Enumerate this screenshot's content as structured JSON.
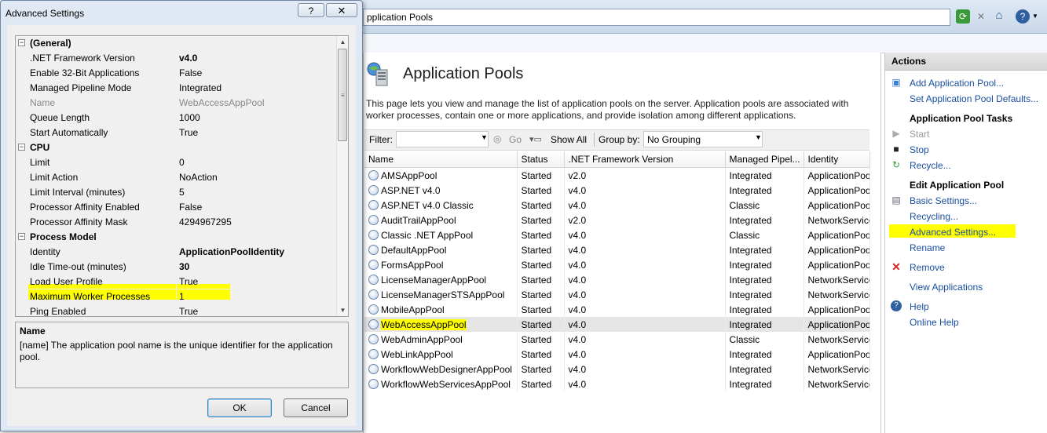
{
  "iis": {
    "address_text": "pplication Pools",
    "page_title": "Application Pools",
    "page_description": "This page lets you view and manage the list of application pools on the server. Application pools are associated with worker processes, contain one or more applications, and provide isolation among different applications.",
    "filter": {
      "label": "Filter:",
      "value": "",
      "go_label": "Go",
      "show_all_label": "Show All",
      "group_by_label": "Group by:",
      "group_by_value": "No Grouping"
    },
    "table": {
      "columns": [
        "Name",
        "Status",
        ".NET Framework Version",
        "Managed Pipel...",
        "Identity"
      ],
      "rows": [
        {
          "name": "AMSAppPool",
          "status": "Started",
          "version": "v2.0",
          "pipeline": "Integrated",
          "identity": "ApplicationPoolIdentity"
        },
        {
          "name": "ASP.NET v4.0",
          "status": "Started",
          "version": "v4.0",
          "pipeline": "Integrated",
          "identity": "ApplicationPoolIdentity"
        },
        {
          "name": "ASP.NET v4.0 Classic",
          "status": "Started",
          "version": "v4.0",
          "pipeline": "Classic",
          "identity": "ApplicationPoolIdentity"
        },
        {
          "name": "AuditTrailAppPool",
          "status": "Started",
          "version": "v2.0",
          "pipeline": "Integrated",
          "identity": "NetworkService"
        },
        {
          "name": "Classic .NET AppPool",
          "status": "Started",
          "version": "v4.0",
          "pipeline": "Classic",
          "identity": "ApplicationPoolIdentity"
        },
        {
          "name": "DefaultAppPool",
          "status": "Started",
          "version": "v4.0",
          "pipeline": "Integrated",
          "identity": "ApplicationPoolIdentity"
        },
        {
          "name": "FormsAppPool",
          "status": "Started",
          "version": "v4.0",
          "pipeline": "Integrated",
          "identity": "ApplicationPoolIdentity"
        },
        {
          "name": "LicenseManagerAppPool",
          "status": "Started",
          "version": "v4.0",
          "pipeline": "Integrated",
          "identity": "NetworkService"
        },
        {
          "name": "LicenseManagerSTSAppPool",
          "status": "Started",
          "version": "v4.0",
          "pipeline": "Integrated",
          "identity": "NetworkService"
        },
        {
          "name": "MobileAppPool",
          "status": "Started",
          "version": "v4.0",
          "pipeline": "Integrated",
          "identity": "ApplicationPoolIdentity"
        },
        {
          "name": "WebAccessAppPool",
          "status": "Started",
          "version": "v4.0",
          "pipeline": "Integrated",
          "identity": "ApplicationPoolIdentity",
          "selected": true
        },
        {
          "name": "WebAdminAppPool",
          "status": "Started",
          "version": "v4.0",
          "pipeline": "Classic",
          "identity": "NetworkService"
        },
        {
          "name": "WebLinkAppPool",
          "status": "Started",
          "version": "v4.0",
          "pipeline": "Integrated",
          "identity": "ApplicationPoolIdentity"
        },
        {
          "name": "WorkflowWebDesignerAppPool",
          "status": "Started",
          "version": "v4.0",
          "pipeline": "Integrated",
          "identity": "NetworkService"
        },
        {
          "name": "WorkflowWebServicesAppPool",
          "status": "Started",
          "version": "v4.0",
          "pipeline": "Integrated",
          "identity": "NetworkService"
        }
      ]
    }
  },
  "actions": {
    "title": "Actions",
    "add_pool": "Add Application Pool...",
    "set_defaults": "Set Application Pool Defaults...",
    "tasks_heading": "Application Pool Tasks",
    "start": "Start",
    "stop": "Stop",
    "recycle": "Recycle...",
    "edit_heading": "Edit Application Pool",
    "basic_settings": "Basic Settings...",
    "recycling": "Recycling...",
    "advanced_settings": "Advanced Settings...",
    "rename": "Rename",
    "remove": "Remove",
    "view_applications": "View Applications",
    "help": "Help",
    "online_help": "Online Help"
  },
  "dialog": {
    "title": "Advanced Settings",
    "help_button": "?",
    "close_button": "✕",
    "categories": {
      "general": "(General)",
      "cpu": "CPU",
      "process_model": "Process Model"
    },
    "properties": {
      "net_version": {
        "name": ".NET Framework Version",
        "value": "v4.0"
      },
      "enable32": {
        "name": "Enable 32-Bit Applications",
        "value": "False"
      },
      "pipeline_mode": {
        "name": "Managed Pipeline Mode",
        "value": "Integrated"
      },
      "name": {
        "name": "Name",
        "value": "WebAccessAppPool"
      },
      "queue_length": {
        "name": "Queue Length",
        "value": "1000"
      },
      "start_auto": {
        "name": "Start Automatically",
        "value": "True"
      },
      "limit": {
        "name": "Limit",
        "value": "0"
      },
      "limit_action": {
        "name": "Limit Action",
        "value": "NoAction"
      },
      "limit_interval": {
        "name": "Limit Interval (minutes)",
        "value": "5"
      },
      "affinity_enabled": {
        "name": "Processor Affinity Enabled",
        "value": "False"
      },
      "affinity_mask": {
        "name": "Processor Affinity Mask",
        "value": "4294967295"
      },
      "identity": {
        "name": "Identity",
        "value": "ApplicationPoolIdentity"
      },
      "idle_timeout": {
        "name": "Idle Time-out (minutes)",
        "value": "30"
      },
      "load_profile": {
        "name": "Load User Profile",
        "value": "True"
      },
      "max_workers": {
        "name": "Maximum Worker Processes",
        "value": "1"
      },
      "ping_enabled": {
        "name": "Ping Enabled",
        "value": "True"
      }
    },
    "description": {
      "title": "Name",
      "text": "[name] The application pool name is the unique identifier for the application pool."
    },
    "ok_label": "OK",
    "cancel_label": "Cancel"
  },
  "colors": {
    "highlight": "#ffff00",
    "link": "#1a4fa0",
    "dialog_frame": "#dfe8f3"
  }
}
